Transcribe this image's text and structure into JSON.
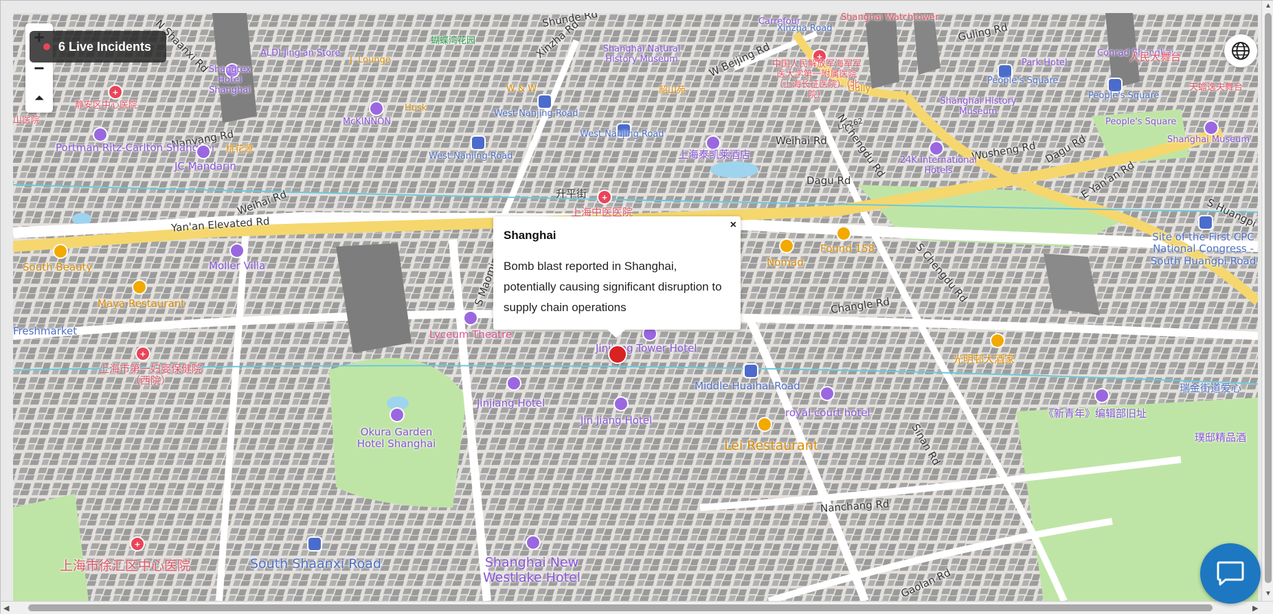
{
  "incidents": {
    "label": "6 Live Incidents"
  },
  "zoom": {
    "in": "+",
    "out": "−",
    "compass": "⏶"
  },
  "popup": {
    "title": "Shanghai",
    "body": "Bomb blast reported in Shanghai, potentially causing significant disruption to supply chain operations",
    "close": "×"
  },
  "streets": [
    "Yan'an Elevated Rd",
    "Weihai Rd",
    "Nanyang Rd",
    "N Shaanxi Rd",
    "Xinzha Rd",
    "W Beijing Rd",
    "Shunde Rd",
    "Weihai Rd",
    "Dagu Rd",
    "Dagu Rd",
    "Wusheng Rd",
    "E Yan'an Rd",
    "S Huangpi",
    "Changle Rd",
    "S Chengdu Rd",
    "N Chengdu Rd",
    "Sinan Rd",
    "Nanchang Rd",
    "Gaolan Rd",
    "S Maoming",
    "Guling Rd",
    "Ln 262",
    "升平街"
  ],
  "pois": [
    "Portman Ritz-Carlton Shanghai",
    "JC Mandarin",
    "Moller Villa",
    "Lyceum Theatre",
    "Jinjiang Tower Hotel",
    "Jinjiang Hotel",
    "Jin Jiang Hotel",
    "Okura Garden Hotel Shanghai",
    "royal court hotel",
    "上海泰凯莱酒店",
    "24K International Hotels",
    "Shanghai New Westlake Hotel",
    "Shanghai Natural History Museum",
    "Shanghai History Museum",
    "Shanghai Museum",
    "People's Square",
    "Site of the First CPC National Congress - South Huangpi Road",
    "《新青年》编辑部旧址",
    "Shangtex Hotel Shanghai",
    "McKINNON",
    "Park Hotel",
    "Conrad Shanghai",
    "人民大舞台",
    "天蟾逸夫舞台",
    "ALDI Jing'an Store",
    "Carrefour",
    "Shanghai Watchtower",
    "璞邸精品酒",
    "瑞金街道爱心",
    "Freshmarket"
  ],
  "food": [
    "South Beauty",
    "Maya Restaurant",
    "Lei Restaurant",
    "Nomad",
    "Found 158",
    "光明邨大酒家",
    "Husk",
    "W & W",
    "桃花源",
    "J. Lounge",
    "韶山苑",
    "Gully"
  ],
  "hospitals": [
    "上海市第一妇婴保健院（西院）",
    "上海市徐汇区中心医院",
    "上海中医医院",
    "静安区中心医院",
    "中国人民解放军海军军医大学第一附属医院（上海长征医院）（北院）",
    "山医院"
  ],
  "transit": [
    "South Shaanxi Road",
    "Middle Huaihai Road",
    "West Nanjing Road",
    "West Nanjing Road",
    "West Nanjing Road",
    "People's Square",
    "People's Square",
    "Xinzha Road"
  ],
  "parks": [
    "蝴蝶湾花园"
  ],
  "colors": {
    "incident": "#d92222",
    "chat": "#1d78c1",
    "poi": "#8a54d8",
    "food": "#d98b00",
    "hospital": "#e05566",
    "transit": "#4e6fc5",
    "park": "#bfe5a6",
    "highway": "#f5d76e"
  }
}
